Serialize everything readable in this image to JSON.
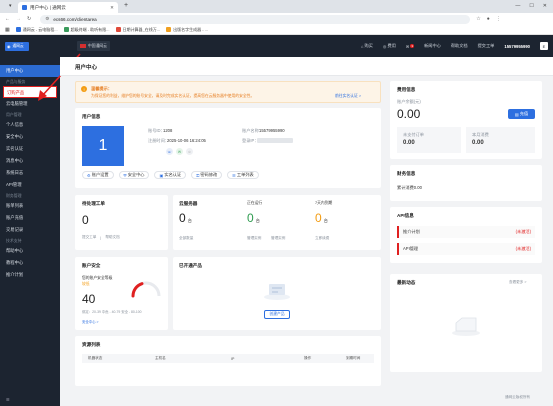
{
  "browser": {
    "tab_title": "用户中心 | 通网云",
    "url": "ecs66.com/clientarea",
    "bookmarks": [
      "通网云 - 云电脑租...",
      "超级终端 - 助听有限...",
      "日期计算器_在线万...",
      "出版名字生成器 - ..."
    ]
  },
  "header": {
    "logo_text": "通网云",
    "region": "中国通网云",
    "nav": [
      "购买",
      "费用",
      "新闻中心",
      "帮助文档",
      "提交工单"
    ],
    "badge_count": "3",
    "phone": "15579955990"
  },
  "sidebar": {
    "items": [
      {
        "type": "item",
        "label": "用户中心",
        "state": "active"
      },
      {
        "type": "group",
        "label": "产品与服务"
      },
      {
        "type": "item",
        "label": "订购产品",
        "state": "boxed"
      },
      {
        "type": "item",
        "label": "云电脑管理",
        "state": ""
      },
      {
        "type": "group",
        "label": "用户管理"
      },
      {
        "type": "item",
        "label": "个人信息",
        "state": ""
      },
      {
        "type": "item",
        "label": "安全中心",
        "state": ""
      },
      {
        "type": "item",
        "label": "实名认证",
        "state": ""
      },
      {
        "type": "item",
        "label": "消息中心",
        "state": ""
      },
      {
        "type": "item",
        "label": "系统日志",
        "state": ""
      },
      {
        "type": "item",
        "label": "API管理",
        "state": ""
      },
      {
        "type": "group",
        "label": "财务管理"
      },
      {
        "type": "item",
        "label": "账单列表",
        "state": ""
      },
      {
        "type": "item",
        "label": "账户充值",
        "state": ""
      },
      {
        "type": "item",
        "label": "交易记录",
        "state": ""
      },
      {
        "type": "group",
        "label": "技术支持"
      },
      {
        "type": "item",
        "label": "帮助中心",
        "state": ""
      },
      {
        "type": "item",
        "label": "教程中心",
        "state": ""
      },
      {
        "type": "item",
        "label": "推介计划",
        "state": ""
      }
    ]
  },
  "page": {
    "title": "用户中心"
  },
  "notice": {
    "title": "温馨提示：",
    "text": "为保证您的利益，维护您的账号安全，请及时完成实名认证，提高您在云服务器中使用的安全性。",
    "link": "前往实名认证 >"
  },
  "userinfo": {
    "title": "用户信息",
    "avatar_char": "1",
    "account_id_label": "账号ID：",
    "account_id": "1208",
    "register_label": "注册时间：",
    "register_time": "2025-10-06 16:24:05",
    "phone_label": "账户名称：",
    "phone": "15579955990",
    "login_label": "登录IP：",
    "buttons": [
      "账户设置",
      "安全中心",
      "实名认证",
      "密码修改",
      "工单列表"
    ]
  },
  "finance": {
    "title": "费用信息",
    "balance_label": "账户余额(元)",
    "balance": "0.00",
    "recharge": "充值",
    "unpaid_label": "未支付订单",
    "unpaid": "0.00",
    "consume_label": "本月消费",
    "consume": "0.00"
  },
  "finance_stats": {
    "title": "财务信息",
    "line": "累计消费0.00"
  },
  "tickets": {
    "title": "待处理工单",
    "count": "0",
    "subs": [
      "提交工单",
      "帮助文档"
    ]
  },
  "servers": {
    "title": "云服务器",
    "total_label": "全部数量",
    "total": "0",
    "total_unit": "台",
    "running_label": "正在运行",
    "running": "0",
    "running_unit": "台",
    "expiring_label": "7天内到期",
    "expiring": "0",
    "expiring_unit": "台",
    "subs": [
      "管理实例",
      "管理实例",
      "立即续费"
    ]
  },
  "api": {
    "title": "API信息",
    "rows": [
      {
        "label": "推介计划",
        "tag": "(未激活)"
      },
      {
        "label": "API管理",
        "tag": "(未激活)"
      }
    ]
  },
  "security": {
    "title": "账户安全",
    "desc": "您的账户安全等级",
    "level": "较低",
    "score": "40",
    "score_pct": 40,
    "detail": "绑定：20-39 中危 - 40-79 安全 - 80-100",
    "link": "安全中心 >"
  },
  "products": {
    "title": "已开通产品",
    "button": "创建产品"
  },
  "recent": {
    "title": "最新动态",
    "more": "查看更多 >"
  },
  "resources": {
    "title": "资源列表",
    "columns": [
      "机器状态",
      "主机名",
      "IP",
      "操作",
      "到期时间"
    ]
  },
  "footer": {
    "text": "通网云版权所有"
  }
}
